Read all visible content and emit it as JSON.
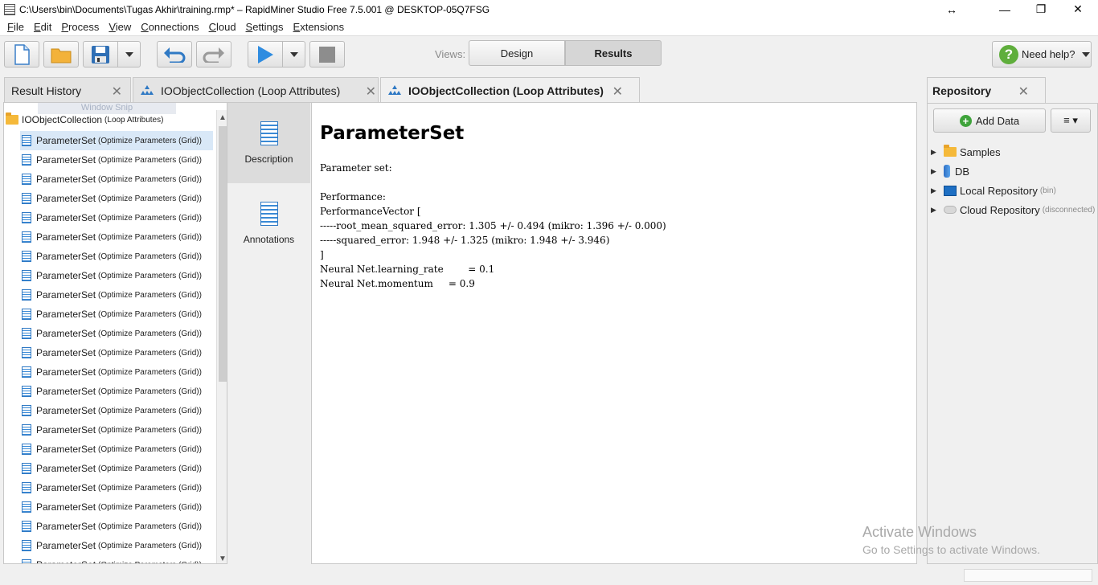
{
  "window": {
    "title": "C:\\Users\\bin\\Documents\\Tugas Akhir\\training.rmp* – RapidMiner Studio Free 7.5.001 @ DESKTOP-05Q7FSG",
    "controls": [
      "↔",
      "—",
      "❐",
      "✕"
    ]
  },
  "menu": [
    "File",
    "Edit",
    "Process",
    "View",
    "Connections",
    "Cloud",
    "Settings",
    "Extensions"
  ],
  "toolbar": {
    "views_label": "Views:",
    "design_label": "Design",
    "results_label": "Results",
    "help_label": "Need help?",
    "help_glyph": "?"
  },
  "tabs": {
    "result_history": "Result History",
    "tab1": "IOObjectCollection (Loop Attributes)",
    "tab2": "IOObjectCollection (Loop Attributes)",
    "close_glyph": "✕"
  },
  "history": {
    "ghost_tip": "Window Snip",
    "root_name": "IOObjectCollection",
    "root_sub": "(Loop Attributes)",
    "items": [
      {
        "name": "ParameterSet",
        "sub": "(Optimize Parameters (Grid))"
      },
      {
        "name": "ParameterSet",
        "sub": "(Optimize Parameters (Grid))"
      },
      {
        "name": "ParameterSet",
        "sub": "(Optimize Parameters (Grid))"
      },
      {
        "name": "ParameterSet",
        "sub": "(Optimize Parameters (Grid))"
      },
      {
        "name": "ParameterSet",
        "sub": "(Optimize Parameters (Grid))"
      },
      {
        "name": "ParameterSet",
        "sub": "(Optimize Parameters (Grid))"
      },
      {
        "name": "ParameterSet",
        "sub": "(Optimize Parameters (Grid))"
      },
      {
        "name": "ParameterSet",
        "sub": "(Optimize Parameters (Grid))"
      },
      {
        "name": "ParameterSet",
        "sub": "(Optimize Parameters (Grid))"
      },
      {
        "name": "ParameterSet",
        "sub": "(Optimize Parameters (Grid))"
      },
      {
        "name": "ParameterSet",
        "sub": "(Optimize Parameters (Grid))"
      },
      {
        "name": "ParameterSet",
        "sub": "(Optimize Parameters (Grid))"
      },
      {
        "name": "ParameterSet",
        "sub": "(Optimize Parameters (Grid))"
      },
      {
        "name": "ParameterSet",
        "sub": "(Optimize Parameters (Grid))"
      },
      {
        "name": "ParameterSet",
        "sub": "(Optimize Parameters (Grid))"
      },
      {
        "name": "ParameterSet",
        "sub": "(Optimize Parameters (Grid))"
      },
      {
        "name": "ParameterSet",
        "sub": "(Optimize Parameters (Grid))"
      },
      {
        "name": "ParameterSet",
        "sub": "(Optimize Parameters (Grid))"
      },
      {
        "name": "ParameterSet",
        "sub": "(Optimize Parameters (Grid))"
      },
      {
        "name": "ParameterSet",
        "sub": "(Optimize Parameters (Grid))"
      },
      {
        "name": "ParameterSet",
        "sub": "(Optimize Parameters (Grid))"
      },
      {
        "name": "ParameterSet",
        "sub": "(Optimize Parameters (Grid))"
      },
      {
        "name": "ParameterSet",
        "sub": "(Optimize Parameters (Grid))"
      }
    ]
  },
  "sidenav": {
    "description": "Description",
    "annotations": "Annotations"
  },
  "content": {
    "heading": "ParameterSet",
    "body": "Parameter set:\n\nPerformance:\nPerformanceVector [\n-----root_mean_squared_error: 1.305 +/- 0.494 (mikro: 1.396 +/- 0.000)\n-----squared_error: 1.948 +/- 1.325 (mikro: 1.948 +/- 3.946)\n]\nNeural Net.learning_rate        = 0.1\nNeural Net.momentum     = 0.9"
  },
  "repository": {
    "title": "Repository",
    "add_data": "Add Data",
    "menu_glyph": "≡ ▾",
    "items": [
      {
        "label": "Samples",
        "note": ""
      },
      {
        "label": "DB",
        "note": ""
      },
      {
        "label": "Local Repository",
        "note": "(bin)"
      },
      {
        "label": "Cloud Repository",
        "note": "(disconnected)"
      }
    ]
  },
  "watermark": {
    "line1": "Activate Windows",
    "line2": "Go to Settings to activate Windows."
  },
  "colors": {
    "accent_blue": "#2f79c4",
    "selected_row": "#d9e8f7",
    "help_green": "#5fae3c"
  }
}
